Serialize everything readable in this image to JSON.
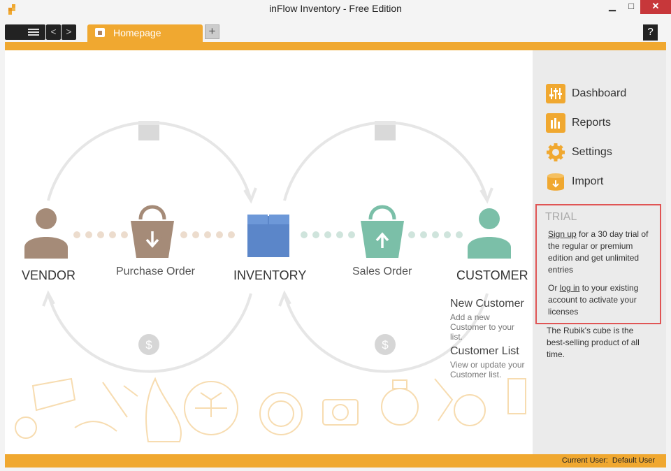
{
  "window": {
    "title": "inFlow Inventory - Free Edition",
    "minimize_glyph": "▁",
    "maximize_glyph": "□",
    "close_glyph": "✕"
  },
  "tabbar": {
    "back_glyph": "<",
    "forward_glyph": ">",
    "tabs": [
      {
        "label": "Homepage",
        "icon": "home-tab-icon",
        "active": true
      }
    ],
    "add_tab_glyph": "+",
    "help_glyph": "?"
  },
  "workflow": {
    "vendor_label": "VENDOR",
    "purchase_order_label": "Purchase Order",
    "inventory_label": "INVENTORY",
    "sales_order_label": "Sales Order",
    "customer_label": "CUSTOMER",
    "payment_symbol": "$",
    "new_customer": {
      "title": "New Customer",
      "description": "Add a new Customer to your list."
    },
    "customer_list": {
      "title": "Customer List",
      "description": "View or update your Customer list."
    }
  },
  "sidebar": {
    "items": [
      {
        "label": "Dashboard",
        "icon": "dashboard-icon"
      },
      {
        "label": "Reports",
        "icon": "reports-icon"
      },
      {
        "label": "Settings",
        "icon": "gear-icon"
      },
      {
        "label": "Import",
        "icon": "import-icon"
      }
    ],
    "trial": {
      "title": "TRIAL",
      "signup_link": "Sign up",
      "signup_text": " for a 30 day trial of the regular or premium edition and get unlimited entries",
      "login_prefix": "Or ",
      "login_link": "log in",
      "login_text": " to your existing account to activate your licenses"
    },
    "tip": "The Rubik's cube is the best-selling product of all time."
  },
  "status": {
    "current_user_label": "Current User:",
    "current_user_value": "Default User"
  },
  "colors": {
    "accent": "#f0a830",
    "vendor": "#a58b78",
    "inventory": "#5b86c9",
    "customer": "#7bbfa8",
    "close": "#c7373a"
  }
}
